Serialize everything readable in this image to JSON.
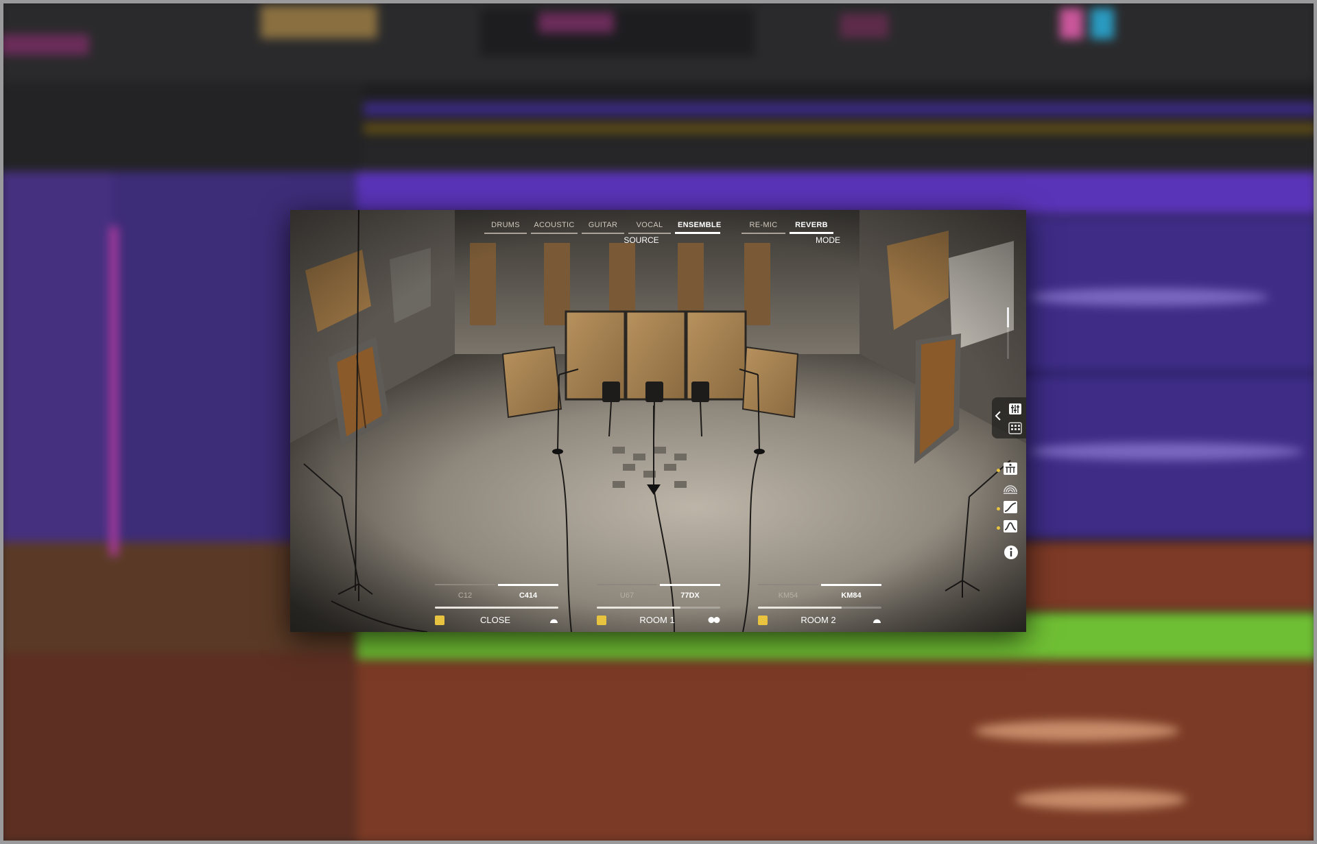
{
  "plugin": {
    "source_tabs": [
      "DRUMS",
      "ACOUSTIC",
      "GUITAR",
      "VOCAL",
      "ENSEMBLE"
    ],
    "source_selected": "ENSEMBLE",
    "source_label": "SOURCE",
    "mode_tabs": [
      "RE-MIC",
      "REVERB"
    ],
    "mode_selected": "REVERB",
    "mode_label": "MODE",
    "mics": [
      {
        "models": [
          "C12",
          "C414"
        ],
        "selected": "C414",
        "name": "CLOSE",
        "level": 1.0,
        "pattern": "cardioid",
        "enabled": true
      },
      {
        "models": [
          "U67",
          "77DX"
        ],
        "selected": "77DX",
        "name": "ROOM 1",
        "level": 0.68,
        "pattern": "figure-8",
        "enabled": true
      },
      {
        "models": [
          "KM54",
          "KM84"
        ],
        "selected": "KM84",
        "name": "ROOM 2",
        "level": 0.68,
        "pattern": "cardioid",
        "enabled": true
      }
    ],
    "side_icons": [
      "mixer-icon",
      "grid-icon",
      "room-view-icon",
      "reverb-tail-icon",
      "eq-curve-icon",
      "filter-curve-icon",
      "info-icon"
    ],
    "vertical_fader_level": 0.38
  },
  "colors": {
    "mic_enable": "#e8c33f",
    "daw_purple": "#4a2e8c",
    "daw_orange": "#7a3a25",
    "daw_green": "#6fbf34"
  }
}
